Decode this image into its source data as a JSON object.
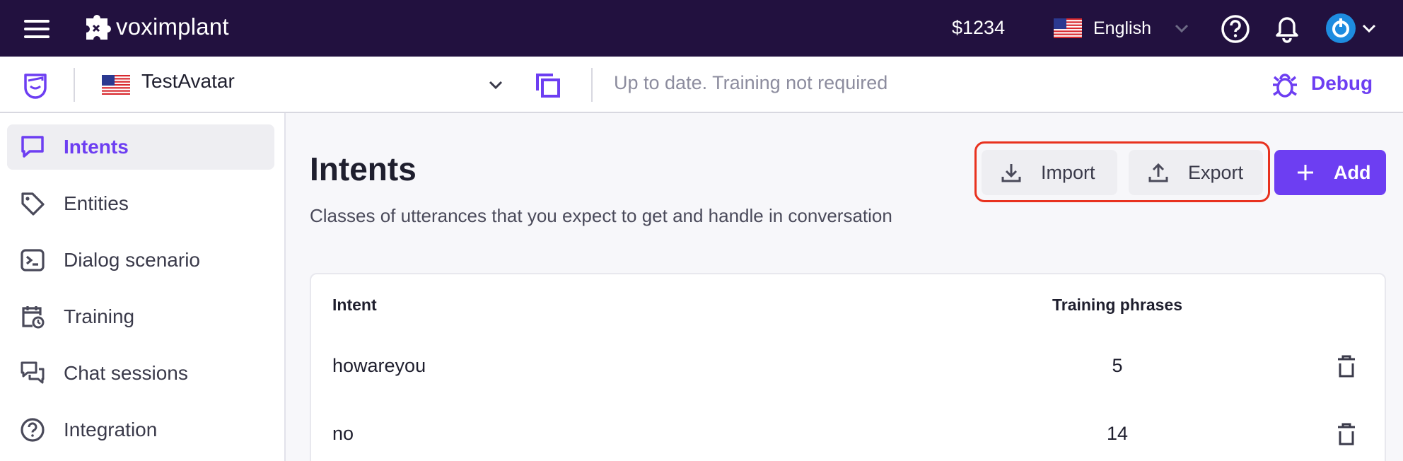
{
  "topbar": {
    "logo_text": "voximplant",
    "balance": "$1234",
    "language": "English"
  },
  "subbar": {
    "project_name": "TestAvatar",
    "status": "Up to date. Training not required",
    "debug_label": "Debug"
  },
  "sidebar": {
    "items": [
      {
        "label": "Intents",
        "icon": "chat-bubble-icon",
        "active": true
      },
      {
        "label": "Entities",
        "icon": "tag-icon",
        "active": false
      },
      {
        "label": "Dialog scenario",
        "icon": "terminal-icon",
        "active": false
      },
      {
        "label": "Training",
        "icon": "calendar-clock-icon",
        "active": false
      },
      {
        "label": "Chat sessions",
        "icon": "chats-icon",
        "active": false
      },
      {
        "label": "Integration",
        "icon": "help-circle-icon",
        "active": false
      }
    ]
  },
  "main": {
    "title": "Intents",
    "subtitle": "Classes of utterances that you expect to get and handle in conversation",
    "import_label": "Import",
    "export_label": "Export",
    "add_label": "Add",
    "table": {
      "columns": [
        "Intent",
        "Training phrases"
      ],
      "rows": [
        {
          "intent": "howareyou",
          "phrases": "5"
        },
        {
          "intent": "no",
          "phrases": "14"
        }
      ]
    }
  },
  "colors": {
    "topbar_bg": "#22113f",
    "accent": "#6d3ef2",
    "highlight": "#e8321f"
  }
}
